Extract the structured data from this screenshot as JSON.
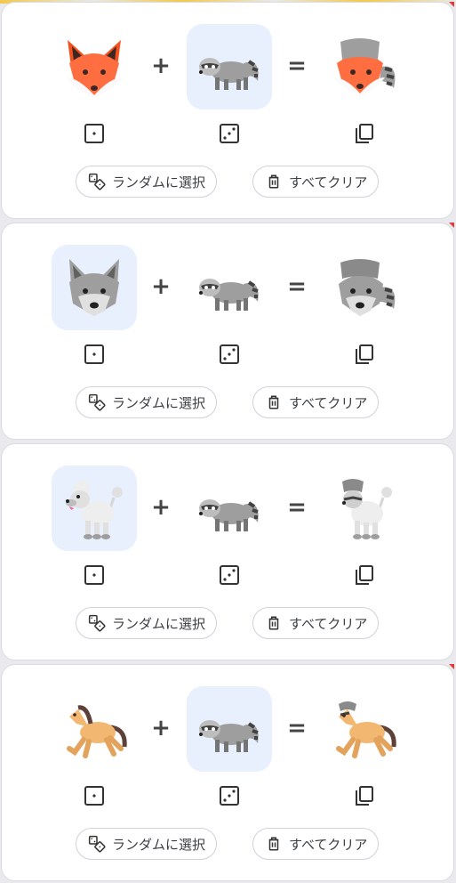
{
  "operators": {
    "plus": "+",
    "equals": "="
  },
  "buttons": {
    "random_label": "ランダムに選択",
    "clear_label": "すべてクリア"
  },
  "icons": {
    "left_dice": "dice-one-icon",
    "middle_dice": "dice-three-icon",
    "copy": "copy-icon",
    "random": "dice-shapes-icon",
    "clear": "trash-icon"
  },
  "colors": {
    "selected_bg": "#e8effd",
    "card_border": "#dadce0",
    "text": "#3c4043"
  },
  "cards": [
    {
      "left": "fox",
      "right": "raccoon",
      "result": "fox + raccoon",
      "selected_slot": "right"
    },
    {
      "left": "wolf",
      "right": "raccoon",
      "result": "wolf + raccoon",
      "selected_slot": "left"
    },
    {
      "left": "poodle",
      "right": "raccoon",
      "result": "poodle + raccoon",
      "selected_slot": "left"
    },
    {
      "left": "horse",
      "right": "raccoon",
      "result": "horse + raccoon",
      "selected_slot": "right"
    }
  ]
}
